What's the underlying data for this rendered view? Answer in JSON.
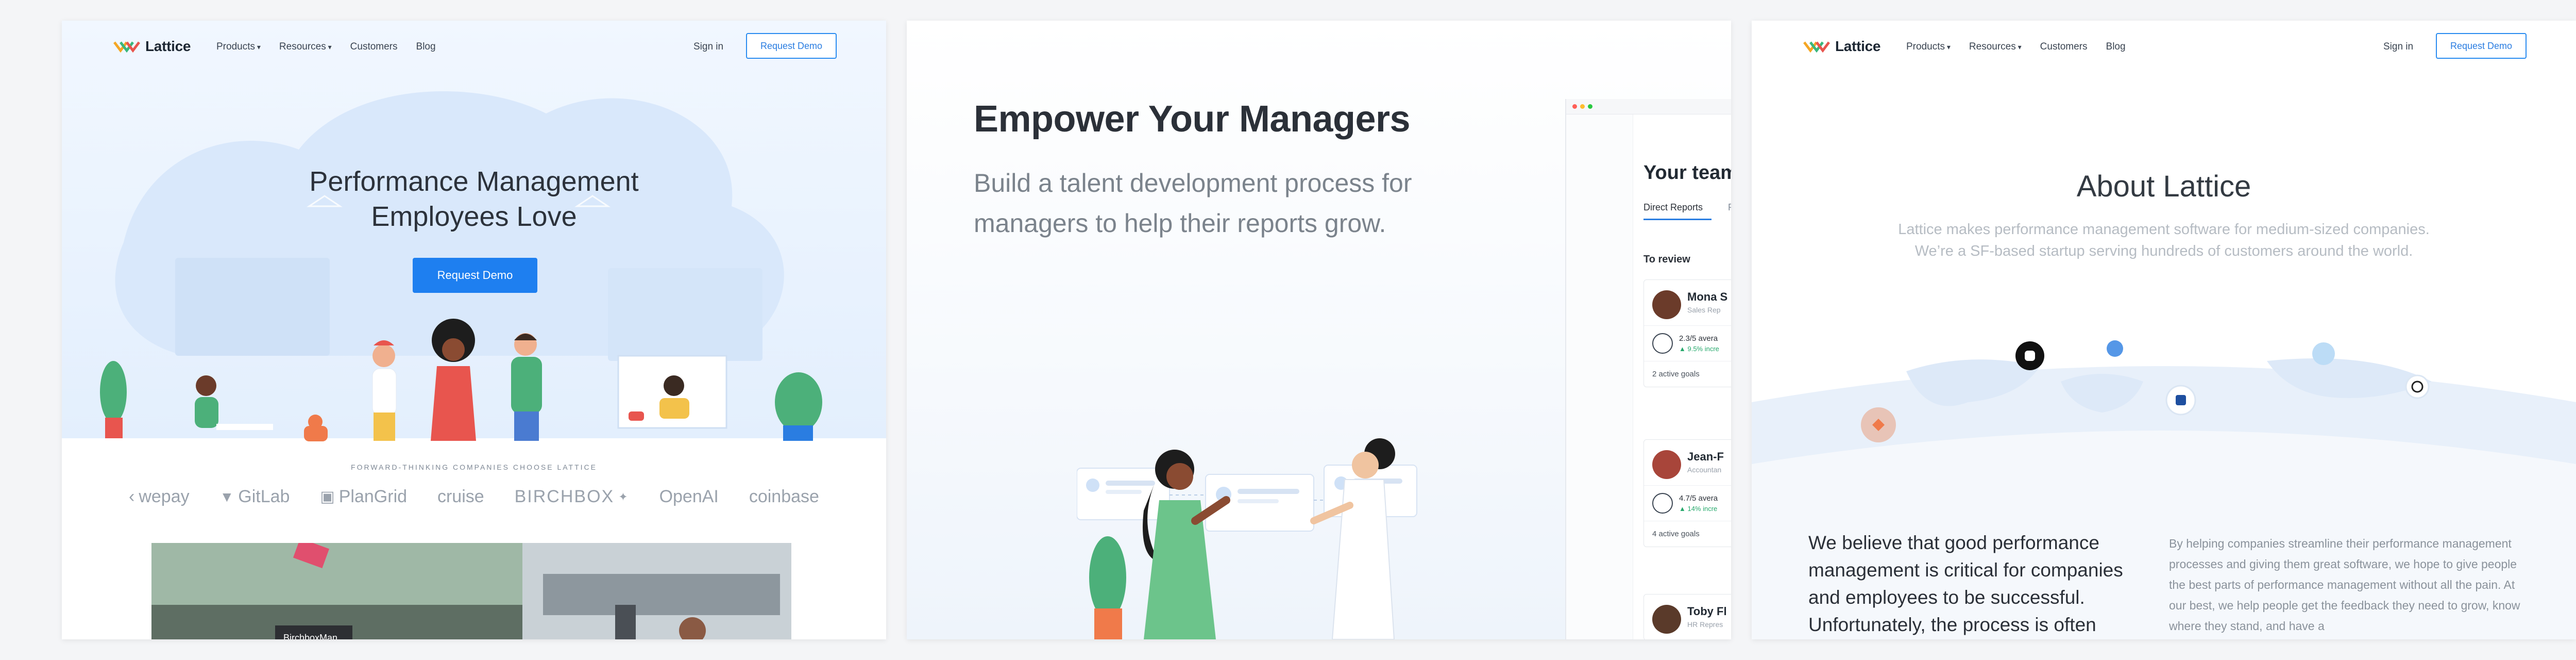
{
  "brand": {
    "name": "Lattice",
    "accent": "#1e7ff0"
  },
  "nav": {
    "links": [
      "Products",
      "Resources",
      "Customers",
      "Blog"
    ],
    "signin": "Sign in",
    "demo": "Request Demo"
  },
  "panel1": {
    "hero_title_line1": "Performance Management",
    "hero_title_line2": "Employees Love",
    "hero_button": "Request Demo",
    "trusted_heading": "FORWARD-THINKING COMPANIES CHOOSE LATTICE",
    "customer_logos": [
      "wepay",
      "GitLab",
      "PlanGrid",
      "cruise",
      "BIRCHBOX",
      "OpenAI",
      "coinbase"
    ],
    "photo_sign": "BirchboxMan"
  },
  "panel2": {
    "title": "Empower Your Managers",
    "subtitle": "Build a talent development process for managers to help their reports grow.",
    "app": {
      "heading": "Your team",
      "tab_active": "Direct Reports",
      "tab_other": "R",
      "section": "To review",
      "cards": [
        {
          "name": "Mona S",
          "role": "Sales Rep",
          "stat": "2.3/5 avera",
          "trend": "▲ 9.5% incre",
          "goals": "2 active goals"
        },
        {
          "name": "Jean-F",
          "role": "Accountan",
          "stat": "4.7/5 avera",
          "trend": "▲ 14% incre",
          "goals": "4 active goals"
        },
        {
          "name": "Toby Fl",
          "role": "HR Repres",
          "stat": "",
          "trend": "",
          "goals": ""
        }
      ]
    }
  },
  "panel3": {
    "title": "About Lattice",
    "subtitle_line1": "Lattice makes performance management software for medium-sized companies.",
    "subtitle_line2": "We’re a SF-based startup serving hundreds of customers around the world.",
    "belief": "We believe that good performance management is critical for companies and employees to be successful. Unfortunately, the process is often",
    "body": "By helping companies streamline their performance management processes and giving them great software, we hope to give people the best parts of performance management without all the pain. At our best, we help people get the feedback they need to grow, know where they stand, and have a"
  }
}
